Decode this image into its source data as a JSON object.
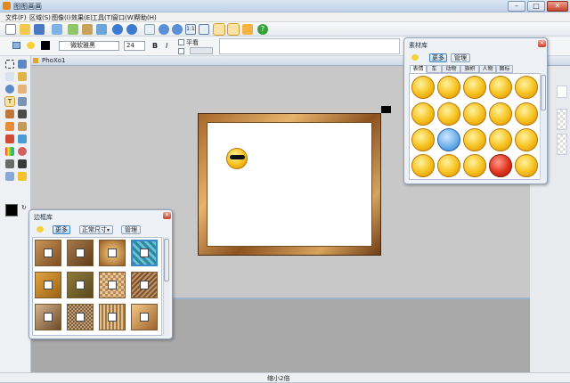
{
  "app": {
    "title": "图图画画"
  },
  "menu": [
    "文件(F)",
    "区域(S)",
    "图像(I)",
    "效果(E)",
    "工具(T)",
    "窗口(W)",
    "帮助(H)"
  ],
  "format": {
    "font": "微软雅黑",
    "size": "24",
    "bold_label": "B",
    "italic_label": "I",
    "flat_label": "平看"
  },
  "document": {
    "tab": "PhoXo1"
  },
  "status": {
    "zoom": "缩小2倍"
  },
  "material_panel": {
    "title": "素材库",
    "more": "更多",
    "manage": "管理",
    "tabs": [
      "表情",
      "车",
      "动物",
      "旗帜",
      "人物",
      "图标"
    ]
  },
  "frame_panel": {
    "title": "边框库",
    "more": "更多",
    "size_select": "正常尺寸",
    "manage": "管理"
  },
  "colors": {
    "accent": "#3c86c9",
    "frame": "#b07436",
    "emoji": "#f6c01b",
    "canvas_bg": "#c8c8c8",
    "workspace_bg": "#a9a9a9"
  }
}
